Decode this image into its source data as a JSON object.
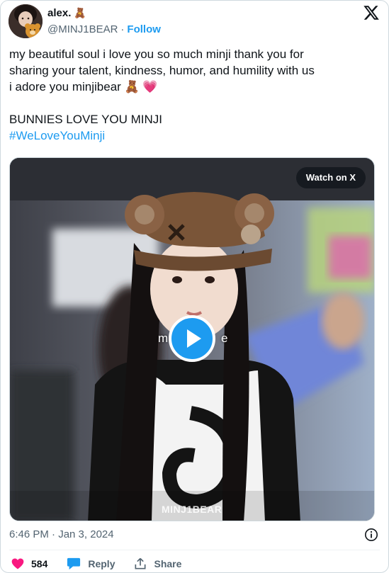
{
  "author": {
    "name": "alex.",
    "name_emoji": "🧸",
    "handle": "@MINJ1BEAR",
    "separator": "·",
    "follow_label": "Follow"
  },
  "tweet": {
    "line1": "my beautiful soul i love you so much minji thank you for",
    "line2": "sharing your talent, kindness, humor, and humility with us",
    "line3": "i adore you minjibear 🧸 💗",
    "line4": "BUNNIES LOVE YOU MINJI",
    "hashtag": "#WeLoveYouMinji"
  },
  "media": {
    "watch_label": "Watch on X",
    "caption_left": "m",
    "caption_right": "e",
    "watermark": "MINJ1BEAR"
  },
  "footer": {
    "timestamp": "6:46 PM · Jan 3, 2024",
    "likes": "584",
    "reply_label": "Reply",
    "share_label": "Share"
  },
  "colors": {
    "accent": "#1d9bf0",
    "like": "#f91880",
    "text": "#0f1419",
    "muted": "#536471"
  }
}
